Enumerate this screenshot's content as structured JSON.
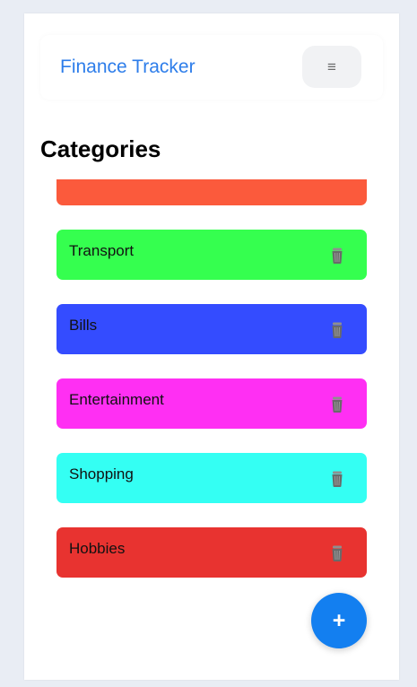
{
  "header": {
    "app_title": "Finance Tracker",
    "menu_icon": "≡",
    "menu_icon_name": "hamburger-menu-icon"
  },
  "main": {
    "title": "Categories",
    "categories": [
      {
        "label": "",
        "color": "#fb5a3c",
        "partially_visible": true
      },
      {
        "label": "Transport",
        "color": "#35ff4f"
      },
      {
        "label": "Bills",
        "color": "#344cff"
      },
      {
        "label": "Entertainment",
        "color": "#ff2ff3"
      },
      {
        "label": "Shopping",
        "color": "#34fff3"
      },
      {
        "label": "Hobbies",
        "color": "#e83330"
      }
    ],
    "delete_icon_name": "trash-icon"
  },
  "fab": {
    "label": "+",
    "icon_name": "plus-icon",
    "color": "#137ff0"
  }
}
